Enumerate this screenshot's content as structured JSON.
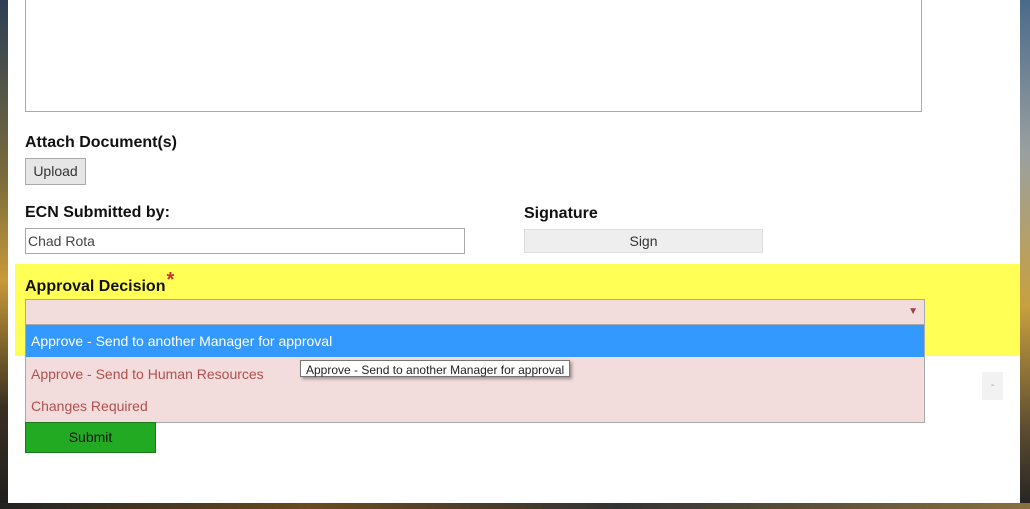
{
  "form": {
    "attach_label": "Attach Document(s)",
    "upload_label": "Upload",
    "submitted_by_label": "ECN Submitted by:",
    "submitted_by_value": "Chad Rota",
    "signature_label": "Signature",
    "sign_label": "Sign",
    "approval_label": "Approval Decision",
    "required_mark": "*",
    "approval_selected": "",
    "approval_options": [
      "Approve - Send to another Manager for approval",
      "Approve - Send to Human Resources",
      "Changes Required"
    ],
    "tooltip_text": "Approve - Send to another Manager for approval",
    "submit_label": "Submit",
    "side_button_label": "-"
  },
  "colors": {
    "highlight_yellow": "#ffff55",
    "option_selected": "#3399ff",
    "option_text": "#b05050",
    "select_bg": "#f2dcdc",
    "submit_green": "#22aa22",
    "required_red": "#d03030"
  }
}
